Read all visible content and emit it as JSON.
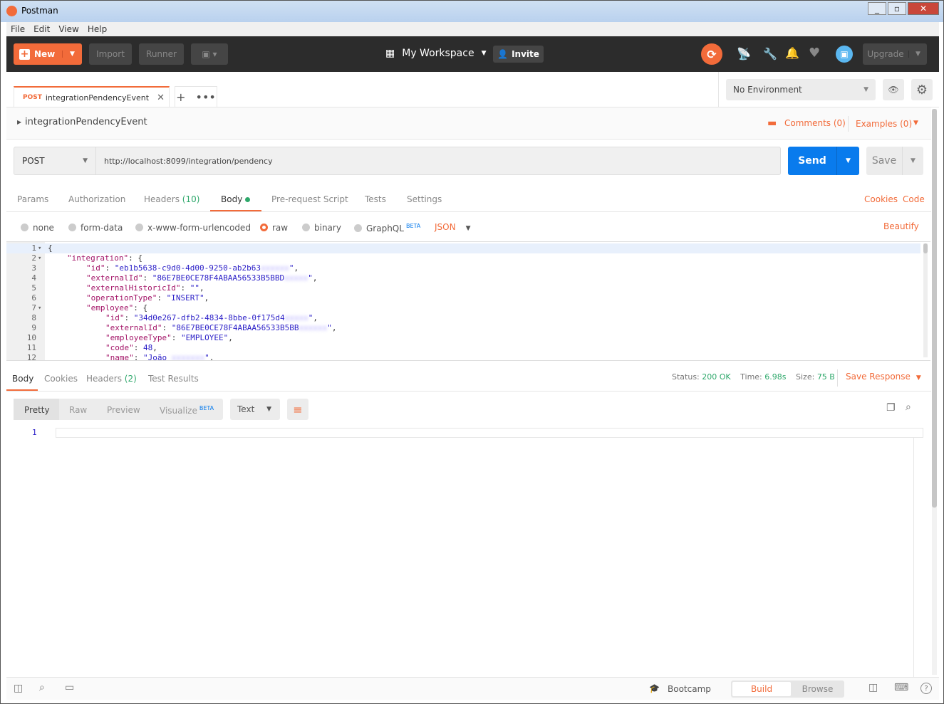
{
  "window": {
    "title": "Postman"
  },
  "menu": [
    "File",
    "Edit",
    "View",
    "Help"
  ],
  "header": {
    "new_label": "New",
    "import_label": "Import",
    "runner_label": "Runner",
    "workspace": "My Workspace",
    "invite_label": "Invite",
    "upgrade_label": "Upgrade"
  },
  "tab": {
    "method": "POST",
    "name": "integrationPendencyEvent"
  },
  "environment": {
    "selected": "No Environment"
  },
  "request": {
    "name": "integrationPendencyEvent",
    "comments": "Comments (0)",
    "examples": "Examples (0)",
    "method": "POST",
    "url": "http://localhost:8099/integration/pendency",
    "send_label": "Send",
    "save_label": "Save"
  },
  "req_tabs": [
    {
      "label": "Params"
    },
    {
      "label": "Authorization"
    },
    {
      "label": "Headers",
      "count": "(10)"
    },
    {
      "label": "Body"
    },
    {
      "label": "Pre-request Script"
    },
    {
      "label": "Tests"
    },
    {
      "label": "Settings"
    }
  ],
  "req_links": {
    "cookies": "Cookies",
    "code": "Code"
  },
  "body_types": [
    "none",
    "form-data",
    "x-www-form-urlencoded",
    "raw",
    "binary",
    "GraphQL"
  ],
  "body_beta": "BETA",
  "body_format": "JSON",
  "beautify": "Beautify",
  "code_lines": [
    {
      "n": "1",
      "fold": true,
      "ind": 0,
      "parts": [
        [
          "p",
          "{"
        ]
      ]
    },
    {
      "n": "2",
      "fold": true,
      "ind": 1,
      "parts": [
        [
          "k",
          "\"integration\""
        ],
        [
          "p",
          ": {"
        ]
      ]
    },
    {
      "n": "3",
      "ind": 2,
      "parts": [
        [
          "k",
          "\"id\""
        ],
        [
          "p",
          ": "
        ],
        [
          "s",
          "\"eb1b5638-c9d0-4d00-9250-ab2b63"
        ],
        [
          "b",
          "xxxxxx"
        ],
        [
          "s",
          "\""
        ],
        [
          "p",
          ","
        ]
      ]
    },
    {
      "n": "4",
      "ind": 2,
      "parts": [
        [
          "k",
          "\"externalId\""
        ],
        [
          "p",
          ": "
        ],
        [
          "s",
          "\"86E7BE0CE78F4ABAA56533B5BBD"
        ],
        [
          "b",
          "xxxxx"
        ],
        [
          "s",
          "\""
        ],
        [
          "p",
          ","
        ]
      ]
    },
    {
      "n": "5",
      "ind": 2,
      "parts": [
        [
          "k",
          "\"externalHistoricId\""
        ],
        [
          "p",
          ": "
        ],
        [
          "s",
          "\"\""
        ],
        [
          "p",
          ","
        ]
      ]
    },
    {
      "n": "6",
      "ind": 2,
      "parts": [
        [
          "k",
          "\"operationType\""
        ],
        [
          "p",
          ": "
        ],
        [
          "s",
          "\"INSERT\""
        ],
        [
          "p",
          ","
        ]
      ]
    },
    {
      "n": "7",
      "fold": true,
      "ind": 2,
      "parts": [
        [
          "k",
          "\"employee\""
        ],
        [
          "p",
          ": {"
        ]
      ]
    },
    {
      "n": "8",
      "ind": 3,
      "parts": [
        [
          "k",
          "\"id\""
        ],
        [
          "p",
          ": "
        ],
        [
          "s",
          "\"34d0e267-dfb2-4834-8bbe-0f175d4"
        ],
        [
          "b",
          "xxxxx"
        ],
        [
          "s",
          "\""
        ],
        [
          "p",
          ","
        ]
      ]
    },
    {
      "n": "9",
      "ind": 3,
      "parts": [
        [
          "k",
          "\"externalId\""
        ],
        [
          "p",
          ": "
        ],
        [
          "s",
          "\"86E7BE0CE78F4ABAA56533B5BB"
        ],
        [
          "b",
          "xxxxxx"
        ],
        [
          "s",
          "\""
        ],
        [
          "p",
          ","
        ]
      ]
    },
    {
      "n": "10",
      "ind": 3,
      "parts": [
        [
          "k",
          "\"employeeType\""
        ],
        [
          "p",
          ": "
        ],
        [
          "s",
          "\"EMPLOYEE\""
        ],
        [
          "p",
          ","
        ]
      ]
    },
    {
      "n": "11",
      "ind": 3,
      "parts": [
        [
          "k",
          "\"code\""
        ],
        [
          "p",
          ": "
        ],
        [
          "s",
          "48"
        ],
        [
          "p",
          ","
        ]
      ]
    },
    {
      "n": "12",
      "ind": 3,
      "parts": [
        [
          "k",
          "\"name\""
        ],
        [
          "p",
          ": "
        ],
        [
          "s",
          "\"João "
        ],
        [
          "b",
          "xxxxxxx"
        ],
        [
          "s",
          "\""
        ],
        [
          "p",
          ","
        ]
      ]
    }
  ],
  "response": {
    "tabs": [
      {
        "label": "Body"
      },
      {
        "label": "Cookies"
      },
      {
        "label": "Headers",
        "count": "(2)"
      },
      {
        "label": "Test Results"
      }
    ],
    "status_label": "Status:",
    "status": "200 OK",
    "time_label": "Time:",
    "time": "6.98s",
    "size_label": "Size:",
    "size": "75 B",
    "save_response": "Save Response",
    "views": [
      "Pretty",
      "Raw",
      "Preview",
      "Visualize"
    ],
    "visualize_beta": "BETA",
    "format": "Text",
    "line_number": "1"
  },
  "footer": {
    "bootcamp": "Bootcamp",
    "build": "Build",
    "browse": "Browse"
  },
  "colors": {
    "accent": "#f26b3a",
    "send": "#097bed",
    "header_bg": "#2c2c2c",
    "success": "#2ea86b"
  }
}
